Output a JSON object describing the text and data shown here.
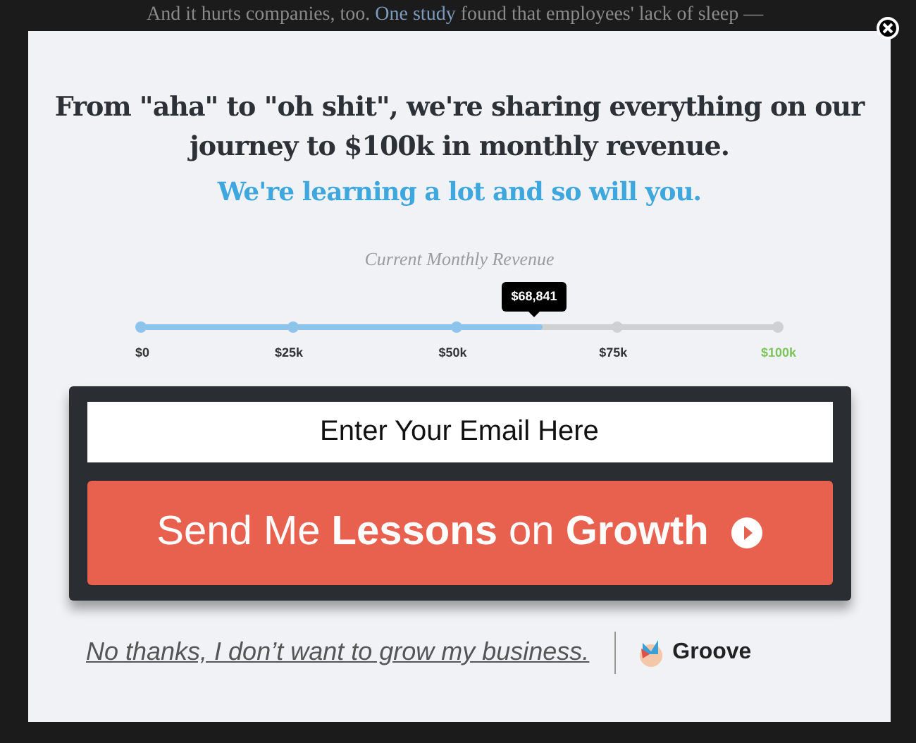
{
  "background_text": {
    "before": "And it hurts companies, too.",
    "link": "One study",
    "after": "found that employees' lack of sleep —"
  },
  "modal": {
    "headline": "From \"aha\" to \"oh shit\", we're sharing everything on our journey to $100k in monthly revenue.",
    "subheadline": "We're learning a lot and so will you.",
    "progress": {
      "label": "Current Monthly Revenue",
      "reading": "$68,841",
      "level": 0.63,
      "ticks": [
        {
          "label": "$0",
          "reached": true,
          "goal": false
        },
        {
          "label": "$25k",
          "reached": true,
          "goal": false
        },
        {
          "label": "$50k",
          "reached": true,
          "goal": false
        },
        {
          "label": "$75k",
          "reached": false,
          "goal": false
        },
        {
          "label": "$100k",
          "reached": false,
          "goal": true
        }
      ]
    },
    "email": {
      "placeholder": "Enter Your Email Here"
    },
    "submit": "Send Me **Lessons** on **Growth**",
    "decline": "No thanks, I don’t want to grow my business.",
    "brand": "Groove"
  }
}
